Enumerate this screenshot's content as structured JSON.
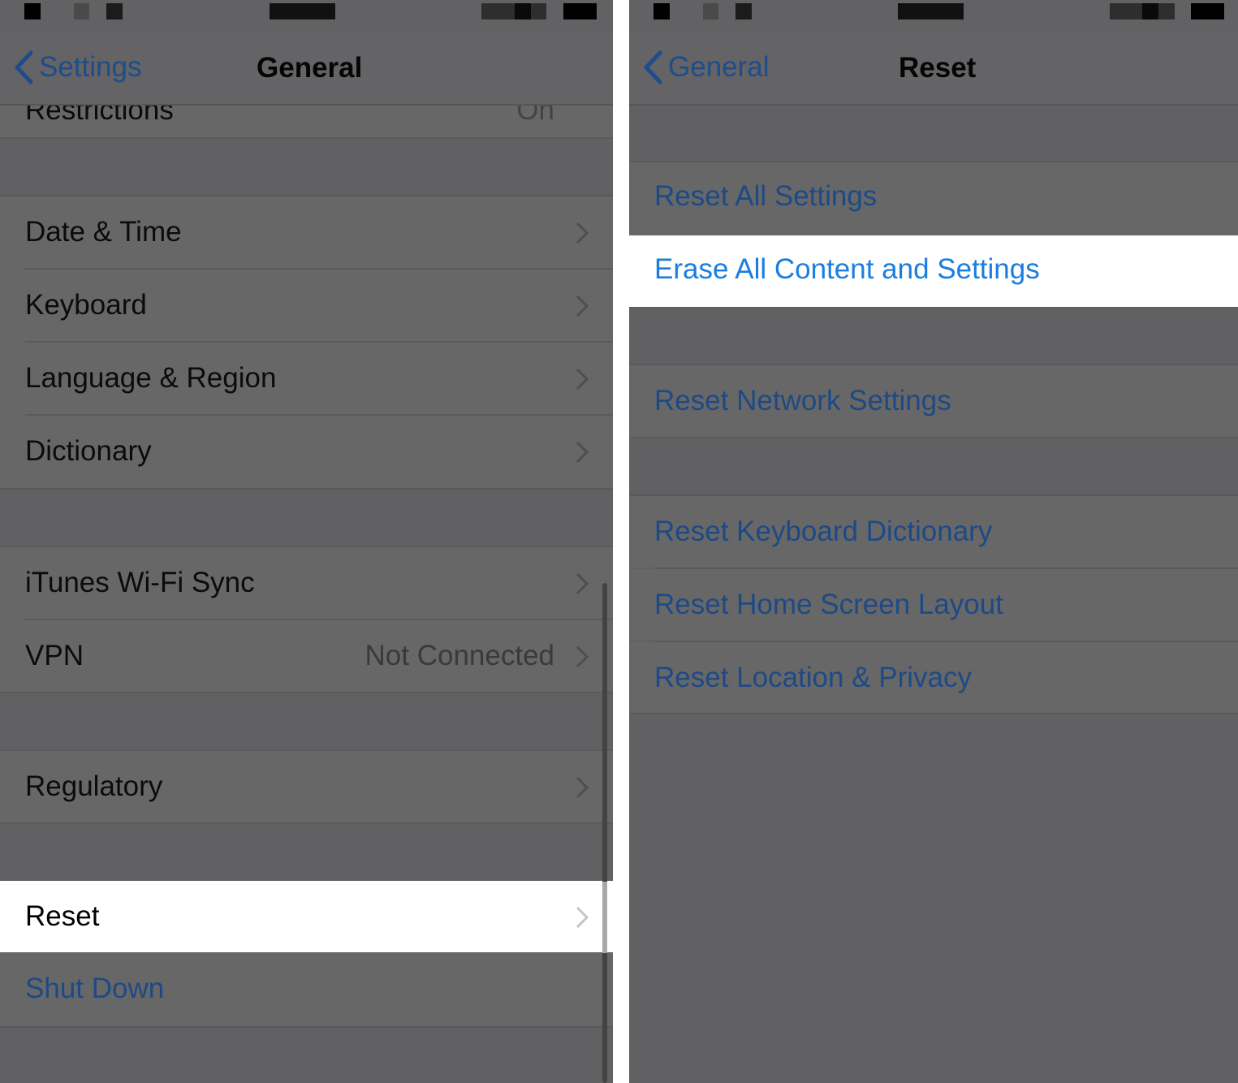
{
  "colors": {
    "dim_background": "#626163",
    "row_background": "#676767",
    "highlight_background": "#ffffff",
    "link_blue_dimmed": "#1d4a86",
    "link_blue": "#1a7ee0"
  },
  "left": {
    "back_label": "Settings",
    "title": "General",
    "partial_row": {
      "label": "Restrictions",
      "value": "On"
    },
    "rows": [
      {
        "label": "Date & Time"
      },
      {
        "label": "Keyboard"
      },
      {
        "label": "Language & Region"
      },
      {
        "label": "Dictionary"
      },
      {
        "label": "iTunes Wi-Fi Sync"
      },
      {
        "label": "VPN",
        "value": "Not Connected"
      },
      {
        "label": "Regulatory"
      },
      {
        "label": "Reset",
        "highlighted": true
      },
      {
        "label": "Shut Down"
      }
    ]
  },
  "right": {
    "back_label": "General",
    "title": "Reset",
    "rows": [
      {
        "label": "Reset All Settings"
      },
      {
        "label": "Erase All Content and Settings",
        "highlighted": true
      },
      {
        "label": "Reset Network Settings"
      },
      {
        "label": "Reset Keyboard Dictionary"
      },
      {
        "label": "Reset Home Screen Layout"
      },
      {
        "label": "Reset Location & Privacy"
      }
    ]
  },
  "icons": {
    "back": "chevron-left-icon",
    "disclosure": "chevron-right-icon"
  }
}
